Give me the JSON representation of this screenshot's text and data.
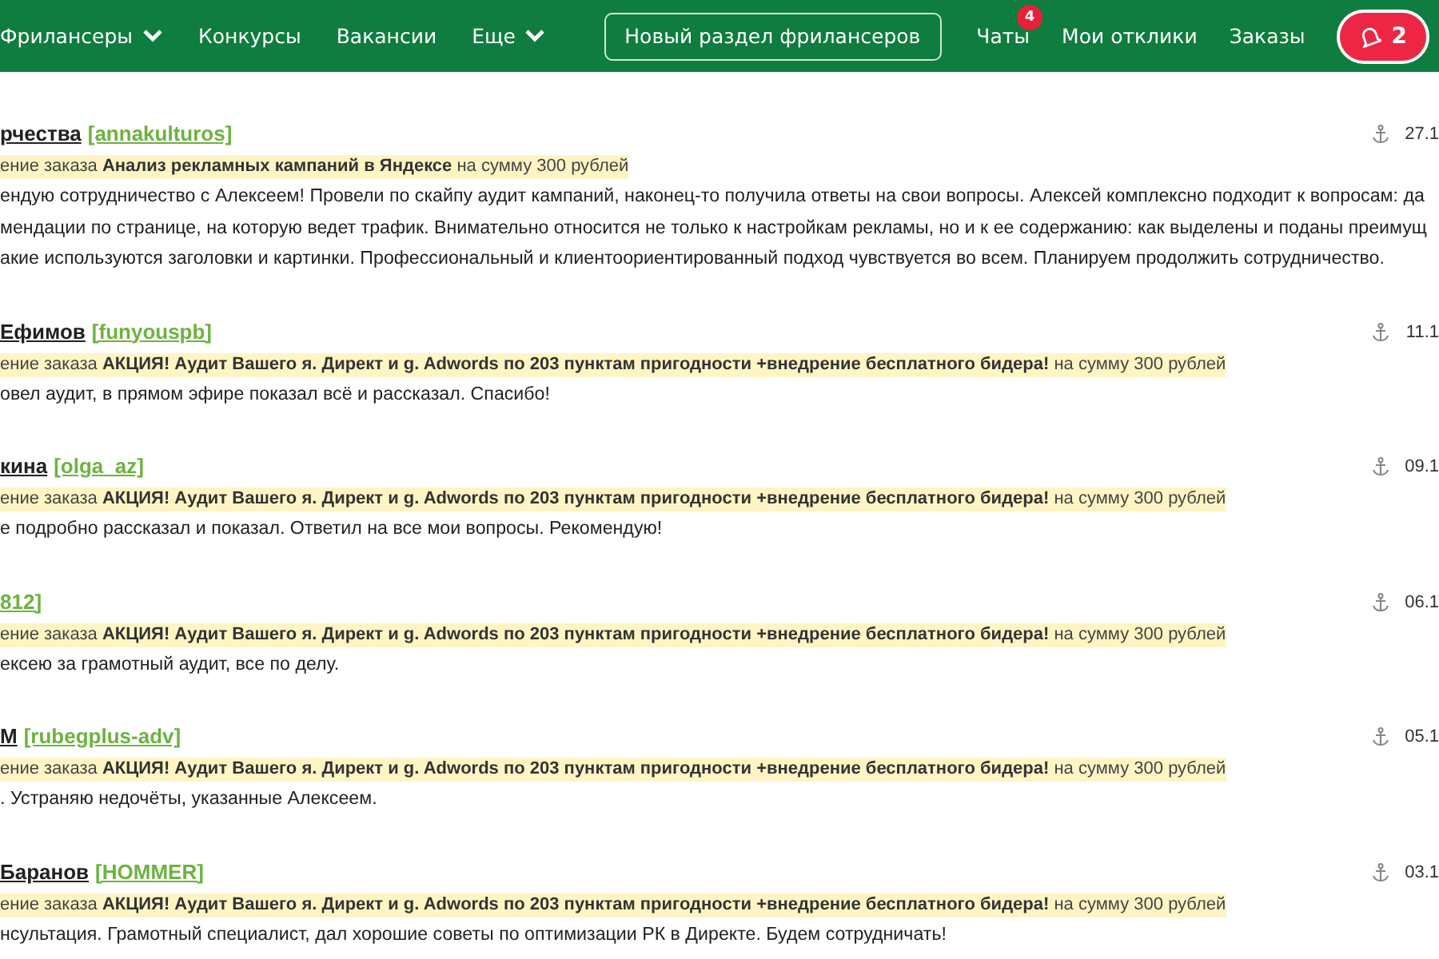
{
  "nav": {
    "items": [
      {
        "label": "Фрилансеры",
        "dropdown": true
      },
      {
        "label": "Конкурсы",
        "dropdown": false
      },
      {
        "label": "Вакансии",
        "dropdown": false
      },
      {
        "label": "Еще",
        "dropdown": true
      }
    ],
    "new_section_button": "Новый раздел фрилансеров",
    "links": [
      {
        "label": "Чаты",
        "badge": "4"
      },
      {
        "label": "Мои отклики"
      },
      {
        "label": "Заказы"
      }
    ],
    "notifications": {
      "count": "2"
    }
  },
  "reviews": [
    {
      "name": "рчества",
      "login": "[annakulturos]",
      "date": "27.1",
      "order": "ение заказа **Анализ рекламных кампаний в Яндексе** на сумму 300 рублей",
      "text": [
        "ендую сотрудничество с Алексеем! Провели по скайпу аудит кампаний, наконец-то получила ответы на свои вопросы. Алексей комплексно подходит к вопросам: да",
        "мендации по странице, на которую ведет трафик. Внимательно относится не только к настройкам рекламы, но и к ее содержанию: как выделены и поданы преимущ",
        "акие используются заголовки и картинки. Профессиональный и клиентоориентированный подход чувствуется во всем. Планируем продолжить сотрудничество."
      ]
    },
    {
      "name": "Ефимов",
      "login": "[funyouspb]",
      "date": "11.1",
      "order": "ение заказа **АКЦИЯ! Аудит Вашего я. Директ и g. Adwords по 203 пунктам пригодности +внедрение бесплатного бидера!** на сумму 300 рублей",
      "text": [
        "овел аудит, в прямом эфире показал всё и рассказал. Спасибо!"
      ]
    },
    {
      "name": "кина",
      "login": "[olga_az]",
      "date": "09.1",
      "order": "ение заказа **АКЦИЯ! Аудит Вашего я. Директ и g. Adwords по 203 пунктам пригодности +внедрение бесплатного бидера!** на сумму 300 рублей",
      "text": [
        "е подробно рассказал и показал. Ответил на все мои вопросы. Рекомендую!"
      ]
    },
    {
      "login": "812]",
      "date": "06.1",
      "order": "ение заказа **АКЦИЯ! Аудит Вашего я. Директ и g. Adwords по 203 пунктам пригодности +внедрение бесплатного бидера!** на сумму 300 рублей",
      "text": [
        "ексею за грамотный аудит, все по делу."
      ]
    },
    {
      "name": "М",
      "login": "[rubegplus-adv]",
      "date": "05.1",
      "order": "ение заказа **АКЦИЯ! Аудит Вашего я. Директ и g. Adwords по 203 пунктам пригодности +внедрение бесплатного бидера!** на сумму 300 рублей",
      "text": [
        ". Устраняю недочёты, указанные Алексеем."
      ]
    },
    {
      "name": "Баранов",
      "login": "[HOMMER]",
      "date": "03.1",
      "order": "ение заказа **АКЦИЯ! Аудит Вашего я. Директ и g. Adwords по 203 пунктам пригодности +внедрение бесплатного бидера!** на сумму 300 рублей",
      "text": [
        "нсультация. Грамотный специалист, дал хорошие советы по оптимизации РК в Директе. Будем сотрудничать!"
      ]
    }
  ]
}
